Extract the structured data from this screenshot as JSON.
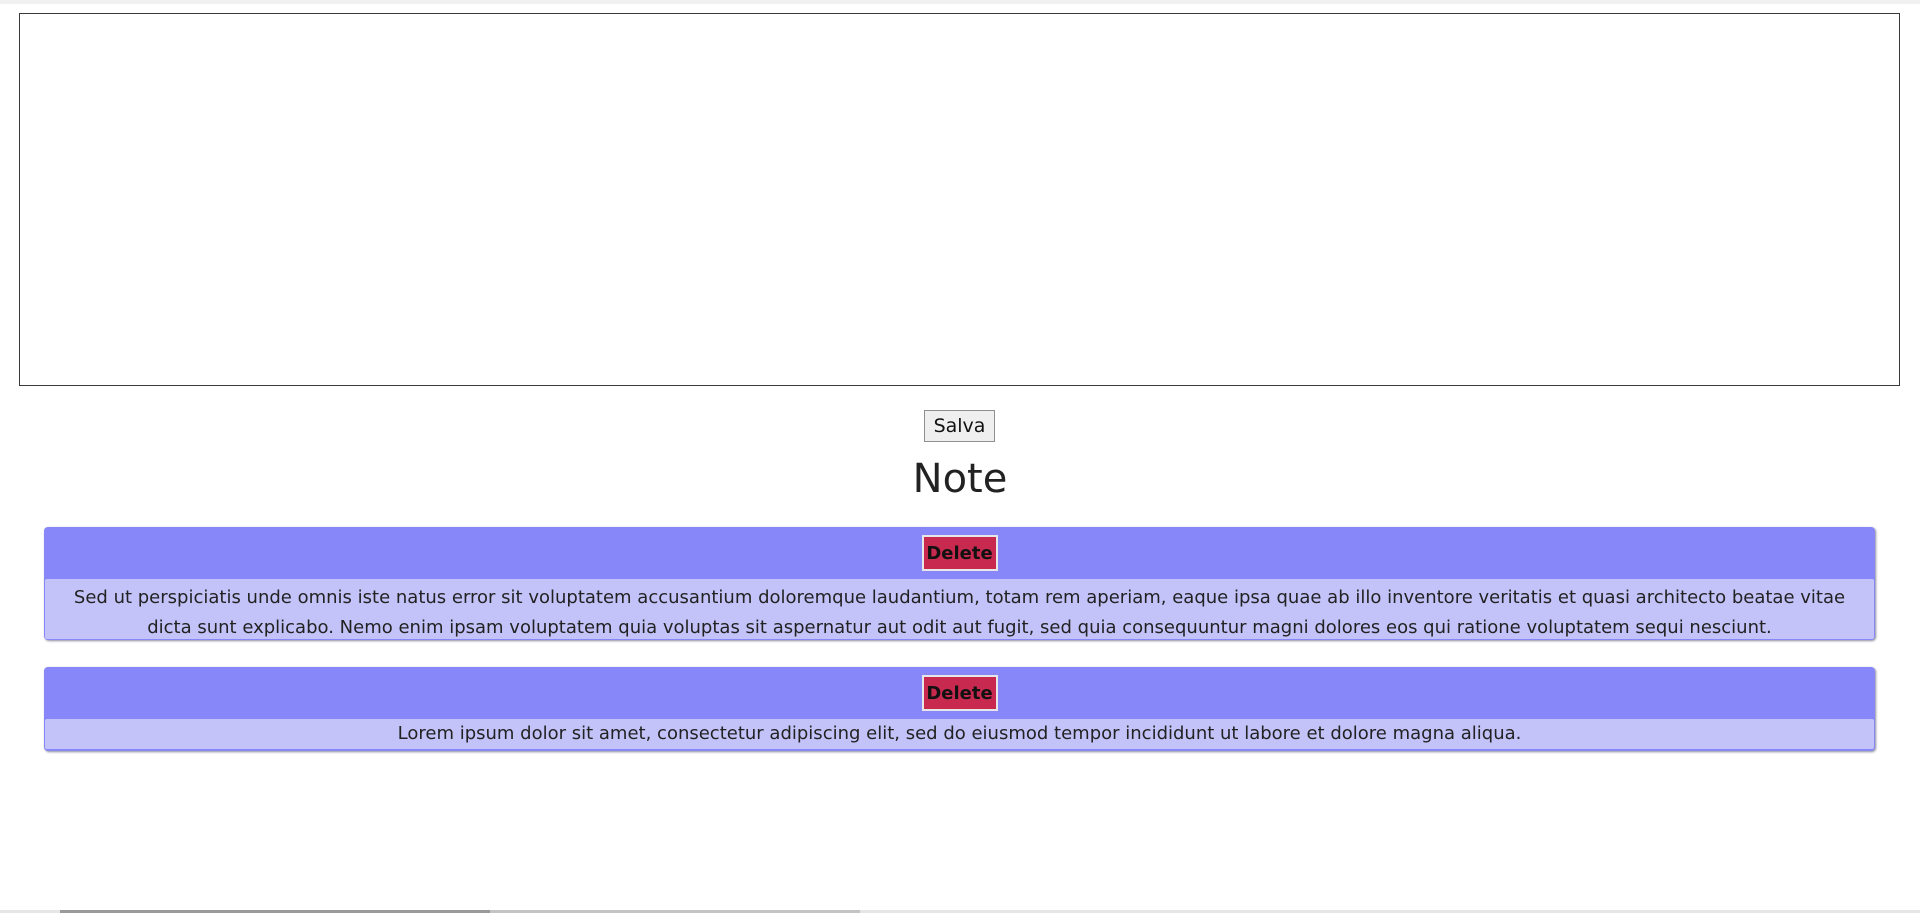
{
  "editor": {
    "textarea_value": ""
  },
  "actions": {
    "save_label": "Salva"
  },
  "notes_section": {
    "title": "Note",
    "notes": [
      {
        "delete_label": "Delete",
        "text": "Sed ut perspiciatis unde omnis iste natus error sit voluptatem accusantium doloremque laudantium, totam rem aperiam, eaque ipsa quae ab illo inventore veritatis et quasi architecto beatae vitae dicta sunt explicabo. Nemo enim ipsam voluptatem quia voluptas sit aspernatur aut odit aut fugit, sed quia consequuntur magni dolores eos qui ratione voluptatem sequi nesciunt."
      },
      {
        "delete_label": "Delete",
        "text": "Lorem ipsum dolor sit amet, consectetur adipiscing elit, sed do eiusmod tempor incididunt ut labore et dolore magna aliqua."
      }
    ]
  },
  "colors": {
    "card_header": "#8787fa",
    "card_body": "#c3c3fa",
    "delete_button": "#c8294e"
  }
}
